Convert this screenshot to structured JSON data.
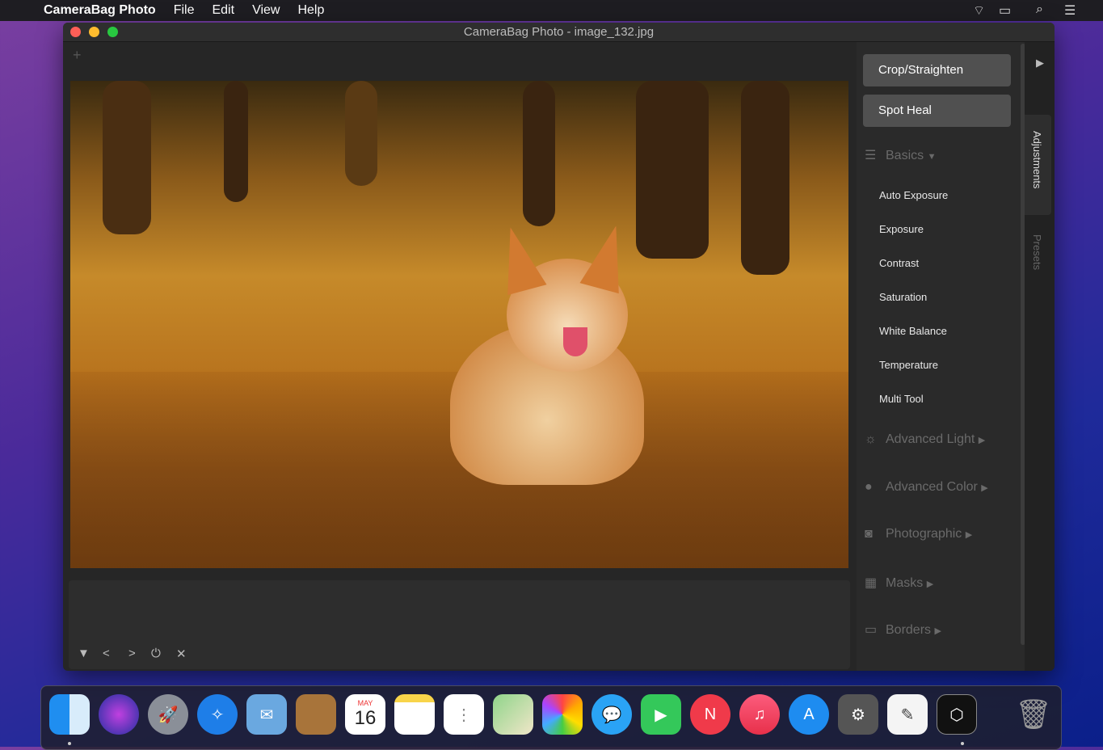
{
  "menubar": {
    "apple_icon": "apple-icon",
    "app": "CameraBag Photo",
    "items": [
      "File",
      "Edit",
      "View",
      "Help"
    ],
    "status_icons": [
      "airplay-icon",
      "display-icon",
      "search-icon",
      "control-center-icon"
    ]
  },
  "window": {
    "title": "CameraBag Photo - image_132.jpg",
    "add_label": "+"
  },
  "photo": {
    "description_icon": "photo-corgi-autumn"
  },
  "bottom_controls": [
    "▼",
    "<",
    ">",
    "⏻",
    "✕"
  ],
  "sidebar": {
    "tools": [
      "Crop/Straighten",
      "Spot Heal"
    ],
    "basics": {
      "label": "Basics",
      "items": [
        "Auto Exposure",
        "Exposure",
        "Contrast",
        "Saturation",
        "White Balance",
        "Temperature",
        "Multi Tool"
      ]
    },
    "sections": [
      "Advanced Light",
      "Advanced Color",
      "Photographic",
      "Masks",
      "Borders"
    ],
    "tabs": [
      "Adjustments",
      "Presets"
    ],
    "collapse_label": "▶"
  },
  "dock": {
    "apps": [
      "Finder",
      "Siri",
      "Launchpad",
      "Safari",
      "Mail",
      "Contacts",
      "Calendar",
      "Notes",
      "Reminders",
      "Maps",
      "Photos",
      "Messages",
      "FaceTime",
      "News",
      "Music",
      "App Store",
      "System Preferences",
      "TextEdit",
      "CameraBag Photo",
      "Trash"
    ],
    "calendar_month": "MAY",
    "calendar_day": "16"
  }
}
